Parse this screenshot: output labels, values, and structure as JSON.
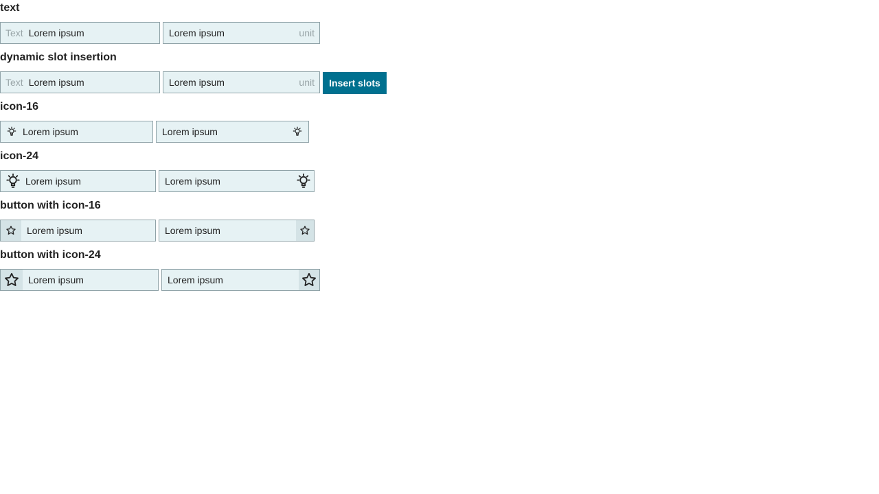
{
  "sections": {
    "text": {
      "heading": "text",
      "field_left": {
        "prefix": "Text",
        "value": "Lorem ipsum"
      },
      "field_right": {
        "value": "Lorem ipsum",
        "suffix": "unit"
      }
    },
    "dynamic": {
      "heading": "dynamic slot insertion",
      "field_left": {
        "prefix": "Text",
        "value": "Lorem ipsum"
      },
      "field_right": {
        "value": "Lorem ipsum",
        "suffix": "unit"
      },
      "button_label": "Insert slots"
    },
    "icon16": {
      "heading": "icon-16",
      "field_left": {
        "value": "Lorem ipsum",
        "icon": "lightbulb-icon"
      },
      "field_right": {
        "value": "Lorem ipsum",
        "icon": "lightbulb-icon"
      }
    },
    "icon24": {
      "heading": "icon-24",
      "field_left": {
        "value": "Lorem ipsum",
        "icon": "lightbulb-icon"
      },
      "field_right": {
        "value": "Lorem ipsum",
        "icon": "lightbulb-icon"
      }
    },
    "btn16": {
      "heading": "button with icon-16",
      "field_left": {
        "value": "Lorem ipsum",
        "icon": "star-icon"
      },
      "field_right": {
        "value": "Lorem ipsum",
        "icon": "star-icon"
      }
    },
    "btn24": {
      "heading": "button with icon-24",
      "field_left": {
        "value": "Lorem ipsum",
        "icon": "star-icon"
      },
      "field_right": {
        "value": "Lorem ipsum",
        "icon": "star-icon"
      }
    }
  },
  "colors": {
    "field_background": "#e6f2f4",
    "field_border": "#90a3a8",
    "affix_text": "#9aa6a9",
    "icon_button_background": "#d4e3e6",
    "primary_button": "#00708f"
  }
}
